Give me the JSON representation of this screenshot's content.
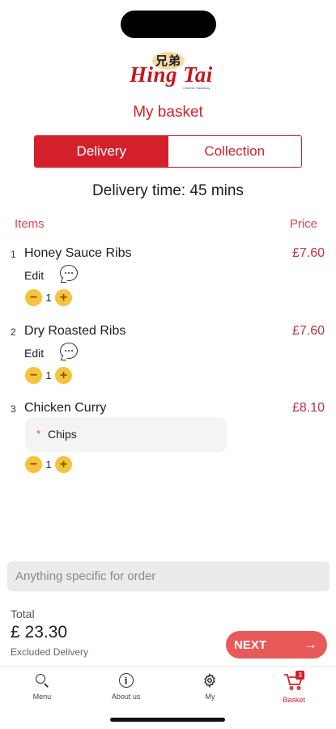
{
  "logo": {
    "cjk_text": "兄弟",
    "script_text": "Hing Tai",
    "tagline": "Chinese Takeaway"
  },
  "page_title": "My basket",
  "order_type": {
    "options": [
      "Delivery",
      "Collection"
    ],
    "selected": "Delivery"
  },
  "delivery_time": "Delivery time: 45 mins",
  "columns": {
    "items": "Items",
    "price": "Price"
  },
  "items": [
    {
      "num": "1",
      "name": "Honey Sauce Ribs",
      "price": "£7.60",
      "edit": "Edit",
      "qty": "1"
    },
    {
      "num": "2",
      "name": "Dry Roasted Ribs",
      "price": "£7.60",
      "edit": "Edit",
      "qty": "1"
    },
    {
      "num": "3",
      "name": "Chicken Curry",
      "price": "£8.10",
      "option_bullet": "*",
      "option": "Chips",
      "qty": "1"
    }
  ],
  "note_placeholder": "Anything specific for order",
  "total": {
    "label": "Total",
    "value": "£ 23.30",
    "note": "Excluded Delivery"
  },
  "next_label": "NEXT",
  "tabs": [
    {
      "label": "Menu",
      "icon": "search-icon"
    },
    {
      "label": "About us",
      "icon": "info-icon"
    },
    {
      "label": "My",
      "icon": "gear-icon"
    },
    {
      "label": "Basket",
      "icon": "cart-icon",
      "badge": "3",
      "active": true
    }
  ],
  "colors": {
    "brand_red": "#d4202a",
    "next_button": "#e85a5a",
    "stepper_yellow": "#f7c23d"
  }
}
